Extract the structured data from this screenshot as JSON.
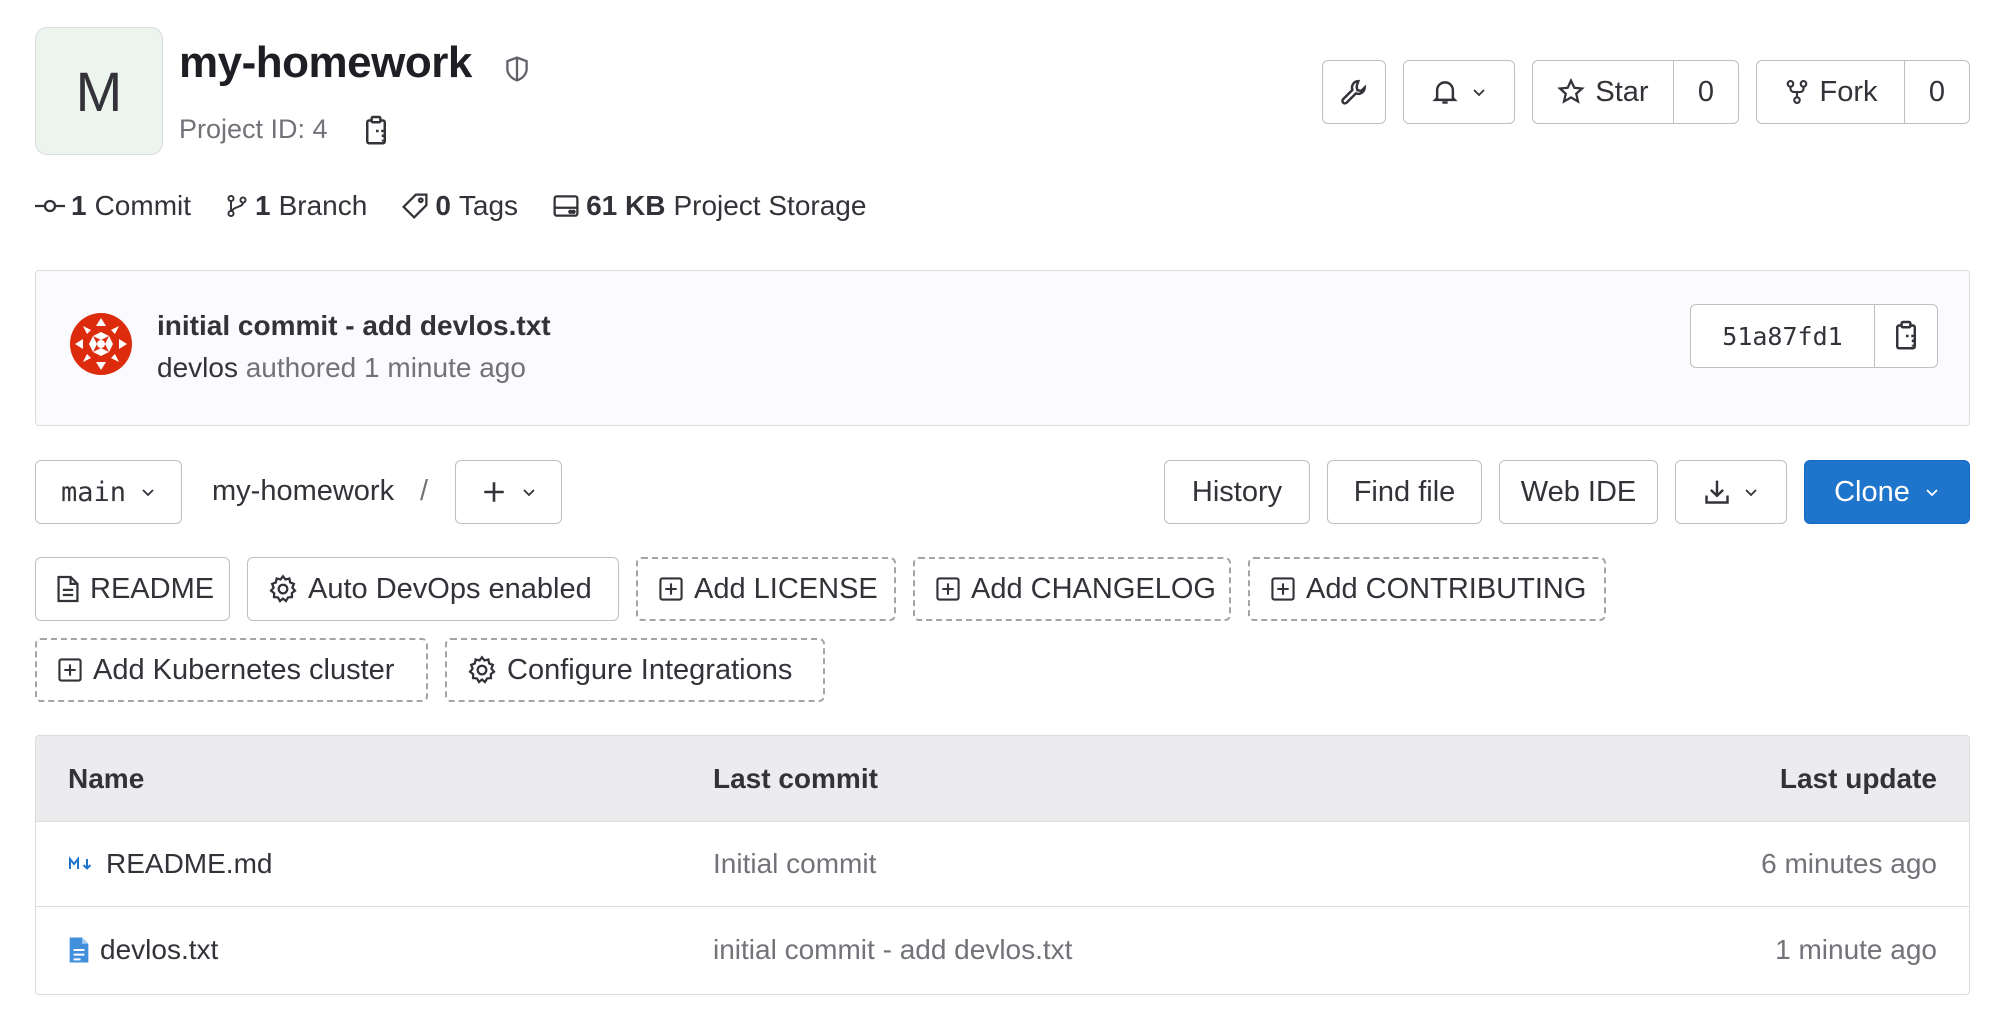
{
  "project": {
    "avatar_letter": "M",
    "title": "my-homework",
    "id_text": "Project ID: 4"
  },
  "header_actions": {
    "star_label": "Star",
    "star_count": "0",
    "fork_label": "Fork",
    "fork_count": "0"
  },
  "stats": [
    {
      "icon": "commit-icon",
      "count": "1",
      "label": "Commit"
    },
    {
      "icon": "branch-icon",
      "count": "1",
      "label": "Branch"
    },
    {
      "icon": "tag-icon",
      "count": "0",
      "label": "Tags"
    },
    {
      "icon": "storage-icon",
      "count": "61 KB",
      "label": "Project Storage"
    }
  ],
  "last_commit": {
    "message": "initial commit - add devlos.txt",
    "author": "devlos",
    "authored_text": "authored 1 minute ago",
    "sha": "51a87fd1"
  },
  "toolbar": {
    "branch": "main",
    "path": "my-homework",
    "path_separator": "/",
    "history": "History",
    "find_file": "Find file",
    "web_ide": "Web IDE",
    "clone": "Clone"
  },
  "shortcuts": [
    {
      "label": "README",
      "style": "solid",
      "icon": "file-icon"
    },
    {
      "label": "Auto DevOps enabled",
      "style": "solid",
      "icon": "settings-icon"
    },
    {
      "label": "Add LICENSE",
      "style": "dashed",
      "icon": "plus-square-icon"
    },
    {
      "label": "Add CHANGELOG",
      "style": "dashed",
      "icon": "plus-square-icon"
    },
    {
      "label": "Add CONTRIBUTING",
      "style": "dashed",
      "icon": "plus-square-icon"
    },
    {
      "label": "Add Kubernetes cluster",
      "style": "dashed",
      "icon": "plus-square-icon"
    },
    {
      "label": "Configure Integrations",
      "style": "dashed",
      "icon": "settings-icon"
    }
  ],
  "file_table": {
    "columns": [
      "Name",
      "Last commit",
      "Last update"
    ],
    "rows": [
      {
        "name": "README.md",
        "icon": "markdown-icon",
        "last_commit": "Initial commit",
        "last_update": "6 minutes ago"
      },
      {
        "name": "devlos.txt",
        "icon": "text-file-icon",
        "last_commit": "initial commit - add devlos.txt",
        "last_update": "1 minute ago"
      }
    ]
  },
  "colors": {
    "primary": "#1f75cb",
    "text": "#333238",
    "muted": "#737278",
    "border": "#bfbfc3",
    "avatar_bg": "#ecf4ee",
    "table_header_bg": "#ececef",
    "commit_avatar": "#dd2b0e"
  }
}
